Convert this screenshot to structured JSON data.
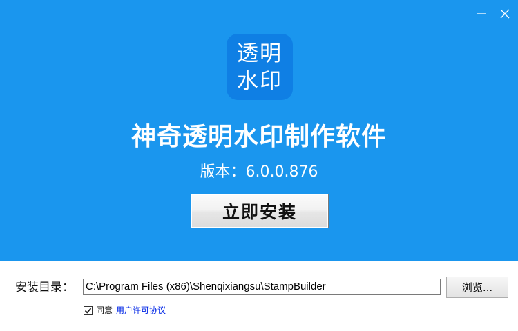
{
  "window": {
    "minimize_icon": "minimize-icon",
    "close_icon": "close-icon"
  },
  "hero": {
    "background_color": "#1a96ee",
    "logo": {
      "line1": "透明",
      "line2": "水印",
      "background_color": "#0f7fe4"
    },
    "title": "神奇透明水印制作软件",
    "version": "版本：6.0.0.876",
    "install_button_label": "立即安装"
  },
  "footer": {
    "dir_label": "安装目录：",
    "dir_value": "C:\\Program Files (x86)\\Shenqixiangsu\\StampBuilder",
    "browse_label": "浏览...",
    "agree_checked": true,
    "agree_label": "同意",
    "license_link": "用户许可协议",
    "link_color": "#0026e6"
  }
}
